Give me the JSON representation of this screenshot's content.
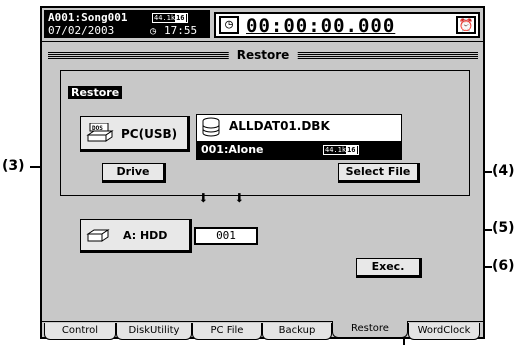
{
  "header": {
    "song_name": "A001:Song001",
    "date": "07/02/2003",
    "format_rate": "44.1k",
    "format_bits": "16",
    "clock_icon": "clock-icon",
    "clock_time": "17:55",
    "locate_icon": "locate-icon",
    "time_counter": "00:00:00.000",
    "alarm_icon": "metronome-icon"
  },
  "page_title": "Restore",
  "restore_section": {
    "label": "Restore",
    "source_button": "PC(USB)",
    "source_icon": "dos-drive-icon",
    "file_name": "ALLDAT01.DBK",
    "selected_song": "001:Alone",
    "song_format_rate": "44.1k",
    "song_format_bits": "16",
    "drive_button": "Drive",
    "select_file_button": "Select File"
  },
  "destination": {
    "drive_button": "A: HDD",
    "song_number": "001"
  },
  "exec_button": "Exec.",
  "tabs": [
    {
      "label": "Control",
      "active": false
    },
    {
      "label": "DiskUtility",
      "active": false
    },
    {
      "label": "PC File",
      "active": false
    },
    {
      "label": "Backup",
      "active": false
    },
    {
      "label": "Restore",
      "active": true
    },
    {
      "label": "WordClock",
      "active": false
    }
  ],
  "callouts": {
    "c3": "(3)",
    "c4": "(4)",
    "c5": "(5)",
    "c6": "(6)"
  }
}
